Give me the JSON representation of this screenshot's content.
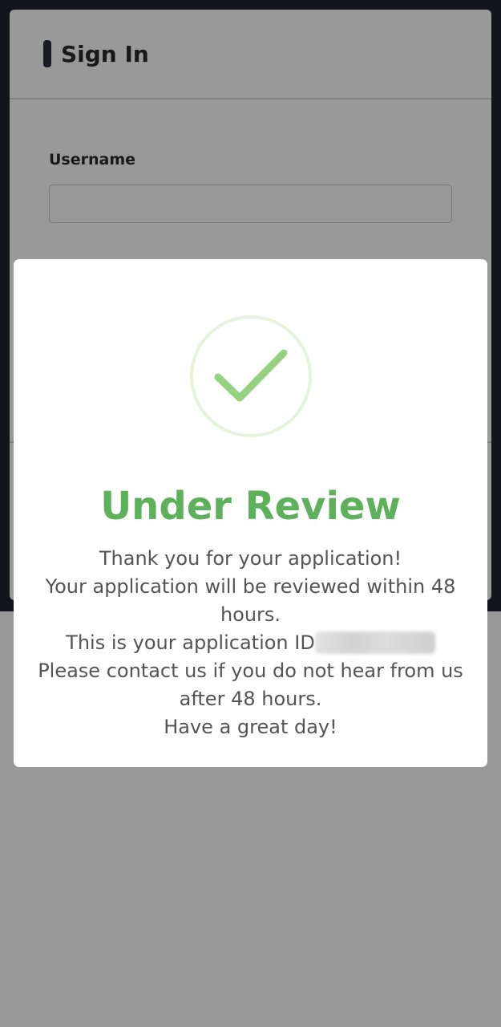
{
  "signin": {
    "title": "Sign In",
    "username_label": "Username",
    "username_value": ""
  },
  "modal": {
    "icon": "checkmark-circle-icon",
    "title": "Under Review",
    "lines": {
      "thanks": "Thank you for your application!",
      "review": "Your application will be reviewed within 48 hours.",
      "id_prefix": "This is your application ID",
      "id_value": "",
      "contact": "Please contact us if you do not hear from us after 48 hours.",
      "closing": "Have a great day!"
    }
  },
  "colors": {
    "success_green": "#5cb15a",
    "check_green": "#95d27f",
    "ring_green": "#e6f3dc",
    "dark_bg": "#1f2430"
  }
}
